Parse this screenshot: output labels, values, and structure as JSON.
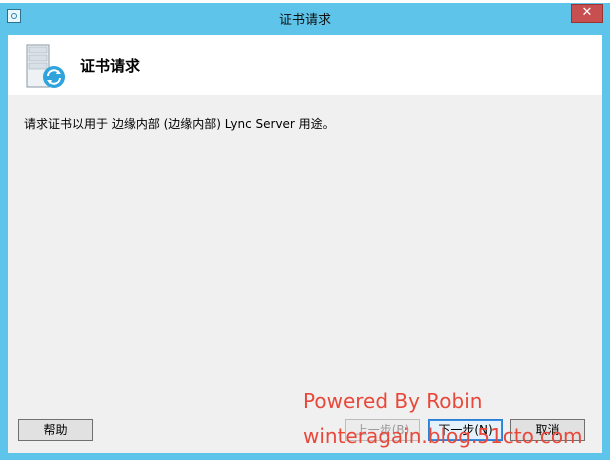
{
  "window": {
    "title": "证书请求",
    "close_label": "✕"
  },
  "header": {
    "title": "证书请求",
    "icon": "server-certificate-icon"
  },
  "body": {
    "description": "请求证书以用于 边缘内部 (边缘内部) Lync Server 用途。"
  },
  "buttons": {
    "help": "帮助",
    "back": "上一步(B)",
    "next": "下一步(N)",
    "cancel": "取消"
  },
  "watermark": {
    "line1": "Powered By Robin",
    "line2": "winteragain.blog.51cto.com"
  },
  "colors": {
    "titlebar": "#5ec4ea",
    "close": "#c74f4f",
    "watermark": "#e8483a"
  }
}
